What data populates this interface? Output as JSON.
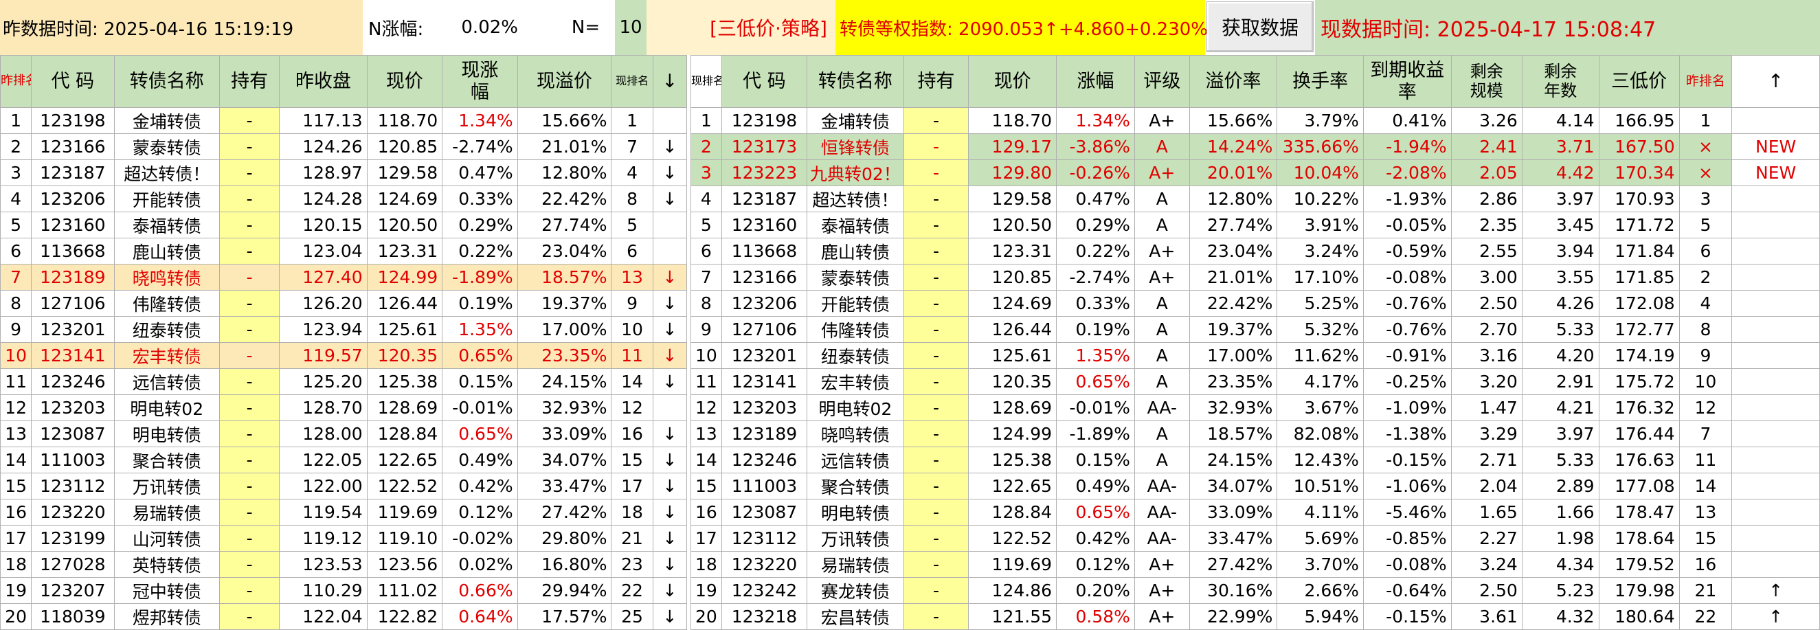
{
  "topbar": {
    "prev_time": "昨数据时间: 2025-04-16 15:19:19",
    "n_label": "N涨幅:",
    "n_value": "0.02%",
    "n_eq": "N=",
    "n_count": "10",
    "strategy": "[三低价·策略]",
    "index_text": "转债等权指数:  2090.053↑+4.860+0.230%",
    "fetch_button": "获取数据",
    "cur_time": "现数据时间: 2025-04-17 15:08:47"
  },
  "left_headers": {
    "rank": "昨排名",
    "code": "代 码",
    "name": "转债名称",
    "hold": "持有",
    "prev_close": "昨收盘",
    "price": "现价",
    "chg": "现涨幅",
    "premium": "现溢价",
    "new_rank": "现排名",
    "arrow": "↓"
  },
  "right_headers": {
    "rank": "现排名",
    "code": "代 码",
    "name": "转债名称",
    "hold": "持有",
    "price": "现价",
    "chg": "涨幅",
    "rating": "评级",
    "premium": "溢价率",
    "turnover": "换手率",
    "ytm": "到期收益率",
    "remain_size": "剩余规模",
    "remain_years": "剩余年数",
    "three_low": "三低价",
    "prev_rank": "昨排名",
    "arrow": "↑"
  },
  "left_rows": [
    {
      "rank": "1",
      "code": "123198",
      "name": "金埔转债",
      "hold": "-",
      "prev_close": "117.13",
      "price": "118.70",
      "chg": "1.34%",
      "chg_red": true,
      "premium": "15.66%",
      "new_rank": "1",
      "arrow": "",
      "style": ""
    },
    {
      "rank": "2",
      "code": "123166",
      "name": "蒙泰转债",
      "hold": "-",
      "prev_close": "124.26",
      "price": "120.85",
      "chg": "-2.74%",
      "chg_red": false,
      "premium": "21.01%",
      "new_rank": "7",
      "arrow": "↓",
      "style": ""
    },
    {
      "rank": "3",
      "code": "123187",
      "name": "超达转债！",
      "hold": "-",
      "prev_close": "128.97",
      "price": "129.58",
      "chg": "0.47%",
      "chg_red": false,
      "premium": "12.80%",
      "new_rank": "4",
      "arrow": "↓",
      "style": ""
    },
    {
      "rank": "4",
      "code": "123206",
      "name": "开能转债",
      "hold": "-",
      "prev_close": "124.28",
      "price": "124.69",
      "chg": "0.33%",
      "chg_red": false,
      "premium": "22.42%",
      "new_rank": "8",
      "arrow": "↓",
      "style": ""
    },
    {
      "rank": "5",
      "code": "123160",
      "name": "泰福转债",
      "hold": "-",
      "prev_close": "120.15",
      "price": "120.50",
      "chg": "0.29%",
      "chg_red": false,
      "premium": "27.74%",
      "new_rank": "5",
      "arrow": "",
      "style": ""
    },
    {
      "rank": "6",
      "code": "113668",
      "name": "鹿山转债",
      "hold": "-",
      "prev_close": "123.04",
      "price": "123.31",
      "chg": "0.22%",
      "chg_red": false,
      "premium": "23.04%",
      "new_rank": "6",
      "arrow": "",
      "style": ""
    },
    {
      "rank": "7",
      "code": "123189",
      "name": "晓鸣转债",
      "hold": "-",
      "prev_close": "127.40",
      "price": "124.99",
      "chg": "-1.89%",
      "chg_red": false,
      "premium": "18.57%",
      "new_rank": "13",
      "arrow": "↓",
      "style": "orange"
    },
    {
      "rank": "8",
      "code": "127106",
      "name": "伟隆转债",
      "hold": "-",
      "prev_close": "126.20",
      "price": "126.44",
      "chg": "0.19%",
      "chg_red": false,
      "premium": "19.37%",
      "new_rank": "9",
      "arrow": "↓",
      "style": ""
    },
    {
      "rank": "9",
      "code": "123201",
      "name": "纽泰转债",
      "hold": "-",
      "prev_close": "123.94",
      "price": "125.61",
      "chg": "1.35%",
      "chg_red": true,
      "premium": "17.00%",
      "new_rank": "10",
      "arrow": "↓",
      "style": ""
    },
    {
      "rank": "10",
      "code": "123141",
      "name": "宏丰转债",
      "hold": "-",
      "prev_close": "119.57",
      "price": "120.35",
      "chg": "0.65%",
      "chg_red": true,
      "premium": "23.35%",
      "new_rank": "11",
      "arrow": "↓",
      "style": "orange"
    },
    {
      "rank": "11",
      "code": "123246",
      "name": "远信转债",
      "hold": "-",
      "prev_close": "125.20",
      "price": "125.38",
      "chg": "0.15%",
      "chg_red": false,
      "premium": "24.15%",
      "new_rank": "14",
      "arrow": "↓",
      "style": ""
    },
    {
      "rank": "12",
      "code": "123203",
      "name": "明电转02",
      "hold": "-",
      "prev_close": "128.70",
      "price": "128.69",
      "chg": "-0.01%",
      "chg_red": false,
      "premium": "32.93%",
      "new_rank": "12",
      "arrow": "",
      "style": ""
    },
    {
      "rank": "13",
      "code": "123087",
      "name": "明电转债",
      "hold": "-",
      "prev_close": "128.00",
      "price": "128.84",
      "chg": "0.65%",
      "chg_red": true,
      "premium": "33.09%",
      "new_rank": "16",
      "arrow": "↓",
      "style": ""
    },
    {
      "rank": "14",
      "code": "111003",
      "name": "聚合转债",
      "hold": "-",
      "prev_close": "122.05",
      "price": "122.65",
      "chg": "0.49%",
      "chg_red": false,
      "premium": "34.07%",
      "new_rank": "15",
      "arrow": "↓",
      "style": ""
    },
    {
      "rank": "15",
      "code": "123112",
      "name": "万讯转债",
      "hold": "-",
      "prev_close": "122.00",
      "price": "122.52",
      "chg": "0.42%",
      "chg_red": false,
      "premium": "33.47%",
      "new_rank": "17",
      "arrow": "↓",
      "style": ""
    },
    {
      "rank": "16",
      "code": "123220",
      "name": "易瑞转债",
      "hold": "-",
      "prev_close": "119.54",
      "price": "119.69",
      "chg": "0.12%",
      "chg_red": false,
      "premium": "27.42%",
      "new_rank": "18",
      "arrow": "↓",
      "style": ""
    },
    {
      "rank": "17",
      "code": "123199",
      "name": "山河转债",
      "hold": "-",
      "prev_close": "119.12",
      "price": "119.10",
      "chg": "-0.02%",
      "chg_red": false,
      "premium": "29.80%",
      "new_rank": "21",
      "arrow": "↓",
      "style": ""
    },
    {
      "rank": "18",
      "code": "127028",
      "name": "英特转债",
      "hold": "-",
      "prev_close": "123.53",
      "price": "123.56",
      "chg": "0.02%",
      "chg_red": false,
      "premium": "16.80%",
      "new_rank": "23",
      "arrow": "↓",
      "style": ""
    },
    {
      "rank": "19",
      "code": "123207",
      "name": "冠中转债",
      "hold": "-",
      "prev_close": "110.29",
      "price": "111.02",
      "chg": "0.66%",
      "chg_red": true,
      "premium": "29.94%",
      "new_rank": "22",
      "arrow": "↓",
      "style": ""
    },
    {
      "rank": "20",
      "code": "118039",
      "name": "煜邦转债",
      "hold": "-",
      "prev_close": "122.04",
      "price": "122.82",
      "chg": "0.64%",
      "chg_red": true,
      "premium": "17.57%",
      "new_rank": "25",
      "arrow": "↓",
      "style": ""
    }
  ],
  "right_rows": [
    {
      "rank": "1",
      "code": "123198",
      "name": "金埔转债",
      "hold": "-",
      "price": "118.70",
      "chg": "1.34%",
      "chg_red": true,
      "rating": "A+",
      "premium": "15.66%",
      "turnover": "3.79%",
      "ytm": "0.41%",
      "size": "3.26",
      "years": "4.14",
      "three_low": "166.95",
      "prev_rank": "1",
      "flag": "",
      "style": ""
    },
    {
      "rank": "2",
      "code": "123173",
      "name": "恒锋转债",
      "hold": "-",
      "price": "129.17",
      "chg": "-3.86%",
      "chg_red": false,
      "rating": "A",
      "premium": "14.24%",
      "turnover": "335.66%",
      "ytm": "-1.94%",
      "size": "2.41",
      "years": "3.71",
      "three_low": "167.50",
      "prev_rank": "×",
      "flag": "NEW",
      "style": "green"
    },
    {
      "rank": "3",
      "code": "123223",
      "name": "九典转02！",
      "hold": "-",
      "price": "129.80",
      "chg": "-0.26%",
      "chg_red": false,
      "rating": "A+",
      "premium": "20.01%",
      "turnover": "10.04%",
      "ytm": "-2.08%",
      "size": "2.05",
      "years": "4.42",
      "three_low": "170.34",
      "prev_rank": "×",
      "flag": "NEW",
      "style": "green"
    },
    {
      "rank": "4",
      "code": "123187",
      "name": "超达转债！",
      "hold": "-",
      "price": "129.58",
      "chg": "0.47%",
      "chg_red": false,
      "rating": "A",
      "premium": "12.80%",
      "turnover": "10.22%",
      "ytm": "-1.93%",
      "size": "2.86",
      "years": "3.97",
      "three_low": "170.93",
      "prev_rank": "3",
      "flag": "",
      "style": ""
    },
    {
      "rank": "5",
      "code": "123160",
      "name": "泰福转债",
      "hold": "-",
      "price": "120.50",
      "chg": "0.29%",
      "chg_red": false,
      "rating": "A",
      "premium": "27.74%",
      "turnover": "3.91%",
      "ytm": "-0.05%",
      "size": "2.35",
      "years": "3.45",
      "three_low": "171.72",
      "prev_rank": "5",
      "flag": "",
      "style": ""
    },
    {
      "rank": "6",
      "code": "113668",
      "name": "鹿山转债",
      "hold": "-",
      "price": "123.31",
      "chg": "0.22%",
      "chg_red": false,
      "rating": "A+",
      "premium": "23.04%",
      "turnover": "3.24%",
      "ytm": "-0.59%",
      "size": "2.55",
      "years": "3.94",
      "three_low": "171.84",
      "prev_rank": "6",
      "flag": "",
      "style": ""
    },
    {
      "rank": "7",
      "code": "123166",
      "name": "蒙泰转债",
      "hold": "-",
      "price": "120.85",
      "chg": "-2.74%",
      "chg_red": false,
      "rating": "A+",
      "premium": "21.01%",
      "turnover": "17.10%",
      "ytm": "-0.08%",
      "size": "3.00",
      "years": "3.55",
      "three_low": "171.85",
      "prev_rank": "2",
      "flag": "",
      "style": ""
    },
    {
      "rank": "8",
      "code": "123206",
      "name": "开能转债",
      "hold": "-",
      "price": "124.69",
      "chg": "0.33%",
      "chg_red": false,
      "rating": "A",
      "premium": "22.42%",
      "turnover": "5.25%",
      "ytm": "-0.76%",
      "size": "2.50",
      "years": "4.26",
      "three_low": "172.08",
      "prev_rank": "4",
      "flag": "",
      "style": ""
    },
    {
      "rank": "9",
      "code": "127106",
      "name": "伟隆转债",
      "hold": "-",
      "price": "126.44",
      "chg": "0.19%",
      "chg_red": false,
      "rating": "A",
      "premium": "19.37%",
      "turnover": "5.32%",
      "ytm": "-0.76%",
      "size": "2.70",
      "years": "5.33",
      "three_low": "172.77",
      "prev_rank": "8",
      "flag": "",
      "style": ""
    },
    {
      "rank": "10",
      "code": "123201",
      "name": "纽泰转债",
      "hold": "-",
      "price": "125.61",
      "chg": "1.35%",
      "chg_red": true,
      "rating": "A",
      "premium": "17.00%",
      "turnover": "11.62%",
      "ytm": "-0.91%",
      "size": "3.16",
      "years": "4.20",
      "three_low": "174.19",
      "prev_rank": "9",
      "flag": "",
      "style": ""
    },
    {
      "rank": "11",
      "code": "123141",
      "name": "宏丰转债",
      "hold": "-",
      "price": "120.35",
      "chg": "0.65%",
      "chg_red": true,
      "rating": "A",
      "premium": "23.35%",
      "turnover": "4.17%",
      "ytm": "-0.25%",
      "size": "3.20",
      "years": "2.91",
      "three_low": "175.72",
      "prev_rank": "10",
      "flag": "",
      "style": ""
    },
    {
      "rank": "12",
      "code": "123203",
      "name": "明电转02",
      "hold": "-",
      "price": "128.69",
      "chg": "-0.01%",
      "chg_red": false,
      "rating": "AA-",
      "premium": "32.93%",
      "turnover": "3.67%",
      "ytm": "-1.09%",
      "size": "1.47",
      "years": "4.21",
      "three_low": "176.32",
      "prev_rank": "12",
      "flag": "",
      "style": ""
    },
    {
      "rank": "13",
      "code": "123189",
      "name": "晓鸣转债",
      "hold": "-",
      "price": "124.99",
      "chg": "-1.89%",
      "chg_red": false,
      "rating": "A",
      "premium": "18.57%",
      "turnover": "82.08%",
      "ytm": "-1.38%",
      "size": "3.29",
      "years": "3.97",
      "three_low": "176.44",
      "prev_rank": "7",
      "flag": "",
      "style": ""
    },
    {
      "rank": "14",
      "code": "123246",
      "name": "远信转债",
      "hold": "-",
      "price": "125.38",
      "chg": "0.15%",
      "chg_red": false,
      "rating": "A",
      "premium": "24.15%",
      "turnover": "12.43%",
      "ytm": "-0.15%",
      "size": "2.71",
      "years": "5.33",
      "three_low": "176.63",
      "prev_rank": "11",
      "flag": "",
      "style": ""
    },
    {
      "rank": "15",
      "code": "111003",
      "name": "聚合转债",
      "hold": "-",
      "price": "122.65",
      "chg": "0.49%",
      "chg_red": false,
      "rating": "AA-",
      "premium": "34.07%",
      "turnover": "10.51%",
      "ytm": "-1.06%",
      "size": "2.04",
      "years": "2.89",
      "three_low": "177.08",
      "prev_rank": "14",
      "flag": "",
      "style": ""
    },
    {
      "rank": "16",
      "code": "123087",
      "name": "明电转债",
      "hold": "-",
      "price": "128.84",
      "chg": "0.65%",
      "chg_red": true,
      "rating": "AA-",
      "premium": "33.09%",
      "turnover": "4.11%",
      "ytm": "-5.46%",
      "size": "1.65",
      "years": "1.66",
      "three_low": "178.47",
      "prev_rank": "13",
      "flag": "",
      "style": ""
    },
    {
      "rank": "17",
      "code": "123112",
      "name": "万讯转债",
      "hold": "-",
      "price": "122.52",
      "chg": "0.42%",
      "chg_red": false,
      "rating": "AA-",
      "premium": "33.47%",
      "turnover": "5.69%",
      "ytm": "-0.85%",
      "size": "2.27",
      "years": "1.98",
      "three_low": "178.64",
      "prev_rank": "15",
      "flag": "",
      "style": ""
    },
    {
      "rank": "18",
      "code": "123220",
      "name": "易瑞转债",
      "hold": "-",
      "price": "119.69",
      "chg": "0.12%",
      "chg_red": false,
      "rating": "A+",
      "premium": "27.42%",
      "turnover": "3.70%",
      "ytm": "-0.08%",
      "size": "3.24",
      "years": "4.34",
      "three_low": "179.52",
      "prev_rank": "16",
      "flag": "",
      "style": ""
    },
    {
      "rank": "19",
      "code": "123242",
      "name": "赛龙转债",
      "hold": "-",
      "price": "124.86",
      "chg": "0.20%",
      "chg_red": false,
      "rating": "A+",
      "premium": "30.16%",
      "turnover": "2.66%",
      "ytm": "-0.64%",
      "size": "2.50",
      "years": "5.23",
      "three_low": "179.98",
      "prev_rank": "21",
      "flag": "↑",
      "style": ""
    },
    {
      "rank": "20",
      "code": "123218",
      "name": "宏昌转债",
      "hold": "-",
      "price": "121.55",
      "chg": "0.58%",
      "chg_red": true,
      "rating": "A+",
      "premium": "22.99%",
      "turnover": "5.94%",
      "ytm": "-0.15%",
      "size": "3.61",
      "years": "4.32",
      "three_low": "180.64",
      "prev_rank": "22",
      "flag": "↑",
      "style": ""
    }
  ],
  "colors": {
    "accent_red": "#e00000",
    "header_green": "#c7e2ba",
    "hold_yellow": "#ffff99",
    "highlight_orange": "#fde9b8"
  }
}
